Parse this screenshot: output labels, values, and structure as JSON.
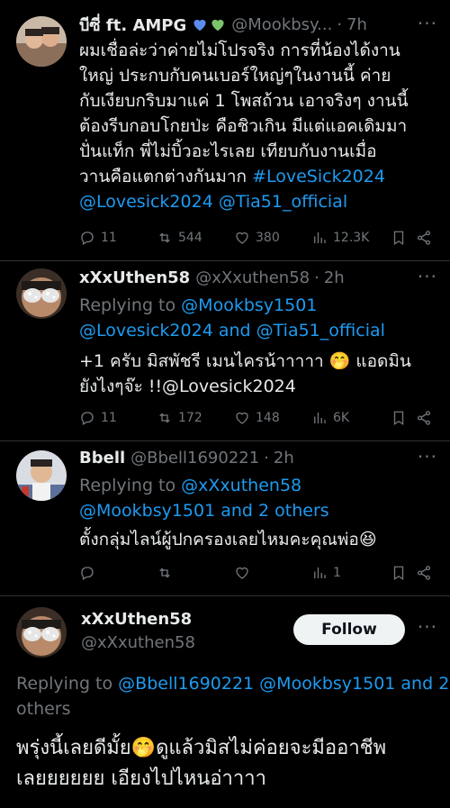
{
  "tweets": [
    {
      "name": "บีซี่ ft. AMPG",
      "handle": "@Mookbsy...",
      "time": "7h",
      "text_lines": [
        "ผมเชื่อล่ะว่าค่ายไม่โปรจริง การที่น้องได้งาน",
        "ใหญ่ ประกบกับคนเบอร์ใหญ่ๆในงานนี้ ค่าย",
        "กับเงียบกริบมาแค่ 1 โพสถ้วน  เอาจริงๆ งานนี้",
        "ต้องรีบกอบโกยป่ะ คือชิวเกิน มีแต่แอคเดิมมา",
        "ปั่นแท็ก พี่ไม่บิ้วอะไรเลย  เทียบกับงานเมื่อ",
        "วานคือแตกต่างกันมาก"
      ],
      "hashtag": "#LoveSick2024",
      "mentions": [
        "@Lovesick2024",
        "@Tia51_official"
      ],
      "stats": {
        "replies": "11",
        "retweets": "544",
        "likes": "380",
        "views": "12.3K"
      }
    },
    {
      "name": "xXxUthen58",
      "handle": "@xXxuthen58",
      "time": "2h",
      "replying_prefix": "Replying to",
      "replying_to_1": "@Mookbsy1501",
      "replying_to_2": "@Lovesick2024",
      "replying_and": "and",
      "replying_to_3": "@Tia51_official",
      "text_line1": "+1 ครับ มิสพัชรี เมนไครน้าาาาา 🤭 แอดมิน",
      "text_line2": "ยังไงๆจ๊ะ !!@Lovesick2024",
      "stats": {
        "replies": "11",
        "retweets": "172",
        "likes": "148",
        "views": "6K"
      }
    },
    {
      "name": "Bbell",
      "handle": "@Bbell1690221",
      "time": "2h",
      "replying_prefix": "Replying to",
      "replying_to_1": "@xXxuthen58",
      "replying_to_2": "@Mookbsy1501 and 2 others",
      "text_line1": "ตั้งกลุ่มไลน์ผู้ปกครองเลยไหมคะคุณพ่อ😆",
      "stats": {
        "replies": "",
        "retweets": "",
        "likes": "",
        "views": "1"
      }
    }
  ],
  "main_tweet": {
    "name": "xXxUthen58",
    "handle": "@xXxuthen58",
    "follow_label": "Follow",
    "replying_prefix": "Replying to",
    "replying_to": "@Bbell1690221 @Mookbsy1501 and 2",
    "replying_tail": "others",
    "text_line1": "พรุ่งนี้เลยดีมั้ย🤭ดูแล้วมิสไม่ค่อยจะมีออาชีพ",
    "text_line2": "เลยยยยยย เอียงไปไหนอ่าาาา"
  },
  "colors": {
    "background": "#000000",
    "link": "#1d9bf0",
    "muted": "#71767b",
    "heart_blue": "#5b8def",
    "heart_green": "#7cc46b"
  }
}
